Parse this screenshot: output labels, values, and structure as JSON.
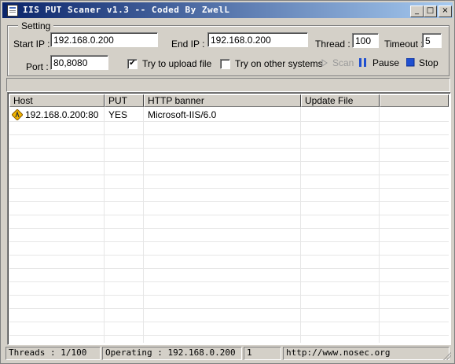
{
  "window": {
    "title": "IIS PUT Scaner v1.3 -- Coded By ZwelL",
    "minimize": "_",
    "maximize": "□",
    "close": "×"
  },
  "setting": {
    "legend": "Setting",
    "start_ip_label": "Start IP :",
    "start_ip_value": "192.168.0.200",
    "end_ip_label": "End IP :",
    "end_ip_value": "192.168.0.200",
    "thread_label": "Thread :",
    "thread_value": "100",
    "timeout_label": "Timeout :",
    "timeout_value": "5",
    "port_label": "Port :",
    "port_value": "80,8080",
    "upload_label": "Try to upload file",
    "upload_checked": "✔",
    "other_systems_label": "Try on other systems",
    "scan_label": "Scan",
    "pause_label": "Pause",
    "stop_label": "Stop"
  },
  "table": {
    "columns": [
      "Host",
      "PUT",
      "HTTP banner",
      "Update File",
      ""
    ],
    "rows": [
      {
        "host": "192.168.0.200:80",
        "put": "YES",
        "banner": "Microsoft-IIS/6.0",
        "update": ""
      }
    ]
  },
  "status": {
    "threads": "Threads : 1/100",
    "operating": "Operating : 192.168.0.200",
    "count": "1",
    "url": "http://www.nosec.org"
  },
  "icons": {
    "app": "app-window-icon",
    "row": "warning-icon",
    "scan": "play-icon",
    "pause": "pause-icon",
    "stop": "stop-icon"
  },
  "colors": {
    "title_start": "#0a246a",
    "title_end": "#a6caf0",
    "accent": "#1f4fd0",
    "disabled": "#9a9a9a"
  }
}
